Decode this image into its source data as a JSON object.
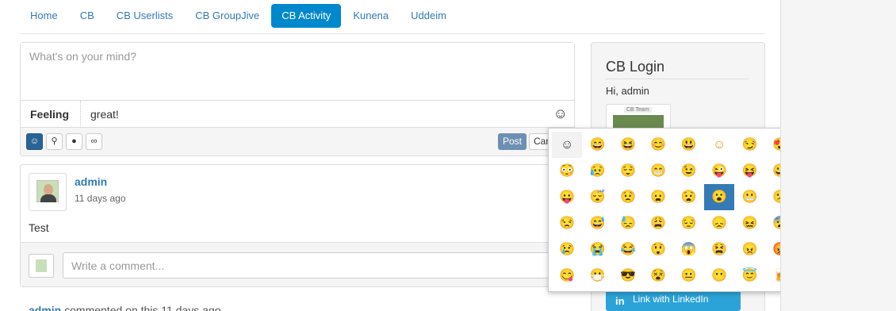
{
  "nav": {
    "items": [
      "Home",
      "CB",
      "CB Userlists",
      "CB GroupJive",
      "CB Activity",
      "Kunena",
      "Uddeim"
    ],
    "active_index": 4
  },
  "composer": {
    "placeholder": "What's on your mind?",
    "feeling_label": "Feeling",
    "feeling_value": "great!",
    "feeling_icon": "smiley-outline-icon",
    "tools": [
      "smiley-icon",
      "location-pin-icon",
      "user-tag-icon",
      "link-icon"
    ],
    "post_label": "Post",
    "cancel_label": "Cancel"
  },
  "activity": {
    "user": "admin",
    "time": "11 days ago",
    "text": "Test",
    "comment_placeholder": "Write a comment..."
  },
  "next_activity": {
    "user": "admin",
    "text": " commented on this 11 days ago"
  },
  "login": {
    "title": "CB Login",
    "greeting": "Hi, admin",
    "avatar_label": "CB Team",
    "linkedin_label": "Link with LinkedIn",
    "linkedin_icon": "in"
  },
  "emoji_picker": {
    "hover_index": 25,
    "current_index": 0,
    "emojis": [
      "☺",
      "😄",
      "😆",
      "😊",
      "😃",
      "☺",
      "😏",
      "😍",
      "😘",
      "😚",
      "😳",
      "😥",
      "😌",
      "😁",
      "😉",
      "😜",
      "😝",
      "😀",
      "😗",
      "😙",
      "😛",
      "😴",
      "😟",
      "😦",
      "😧",
      "😮",
      "😬",
      "😕",
      "😯",
      "😑",
      "😒",
      "😅",
      "😓",
      "😩",
      "😔",
      "😞",
      "😖",
      "😨",
      "😰",
      "😣",
      "😢",
      "😭",
      "😂",
      "😲",
      "😱",
      "😫",
      "😠",
      "😡",
      "😤",
      "😪",
      "😋",
      "😷",
      "😎",
      "😵",
      "😐",
      "😶",
      "😇",
      "🍺",
      "☕",
      "🎉"
    ]
  }
}
